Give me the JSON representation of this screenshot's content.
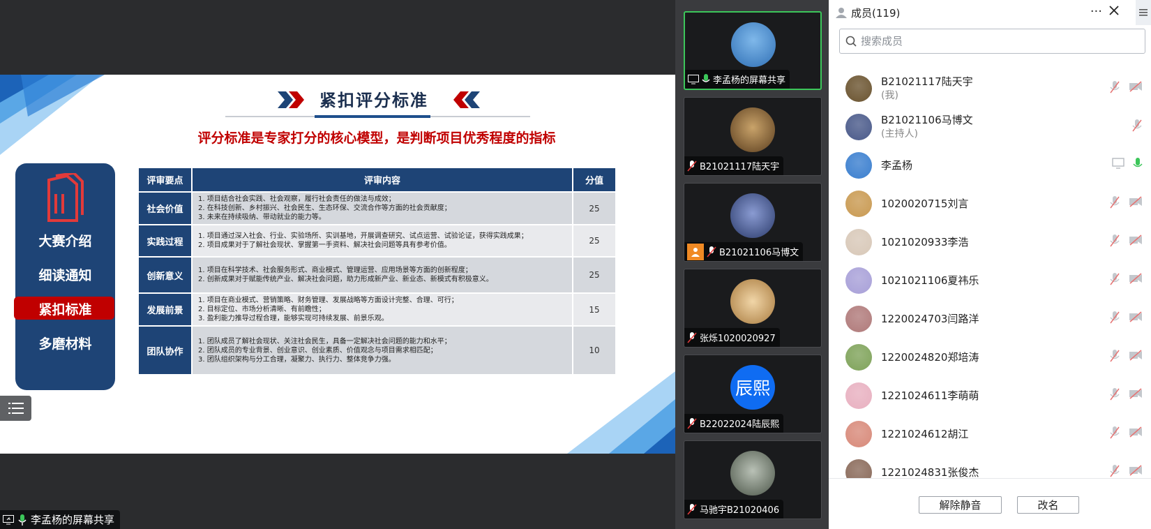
{
  "slide": {
    "title": "紧扣评分标准",
    "subtitle": "评分标准是专家打分的核心模型，是判断项目优秀程度的指标",
    "nav": [
      "大赛介绍",
      "细读通知",
      "紧扣标准",
      "多磨材料"
    ],
    "table": {
      "headers": [
        "评审要点",
        "评审内容",
        "分值"
      ],
      "rows": [
        {
          "aspect": "社会价值",
          "lines": [
            "1. 项目结合社会实践、社会观察，履行社会责任的做法与成效；",
            "2. 在科技创新、乡村振兴、社会民生、生态环保、交流合作等方面的社会贡献度；",
            "3. 未来在持续吸纳、带动就业的能力等。"
          ],
          "score": "25"
        },
        {
          "aspect": "实践过程",
          "lines": [
            "1. 项目通过深入社会、行业、实验场所、实训基地，开展调查研究、试点运营、试验论证，获得实践成果；",
            "2. 项目成果对于了解社会现状、掌握第一手资料、解决社会问题等具有参考价值。"
          ],
          "score": "25"
        },
        {
          "aspect": "创新意义",
          "lines": [
            "1. 项目在科学技术、社会服务形式、商业模式、管理运营、应用场景等方面的创新程度；",
            "2. 创新成果对于赋能传统产业、解决社会问题，助力形成新产业、新业态、新模式有积极意义。"
          ],
          "score": "25"
        },
        {
          "aspect": "发展前景",
          "lines": [
            "1. 项目在商业模式、营销策略、财务管理、发展战略等方面设计完整、合理、可行；",
            "2. 目标定位、市场分析清晰、有前瞻性；",
            "3. 盈利能力推导过程合理，能够实现可持续发展、前景乐观。"
          ],
          "score": "15"
        },
        {
          "aspect": "团队协作",
          "lines": [
            "1. 团队成员了解社会现状、关注社会民生，具备一定解决社会问题的能力和水平；",
            "2. 团队成员的专业背景、创业意识、创业素质、价值观念与项目需求相匹配；",
            "3. 团队组织架构与分工合理，凝聚力、执行力、整体竞争力强。"
          ],
          "score": "10"
        }
      ]
    }
  },
  "share_label": "李孟杨的屏幕共享",
  "video_tiles": [
    {
      "name": "李孟杨的屏幕共享",
      "active": true
    },
    {
      "name": "B21021117陆天宇",
      "active": false
    },
    {
      "name": "B21021106马博文",
      "active": false
    },
    {
      "name": "张烁1020020927",
      "active": false
    },
    {
      "name": "B22022024陆辰熙",
      "active": false,
      "avatar_text": "辰熙"
    },
    {
      "name": "马驰宇B21020406",
      "active": false
    }
  ],
  "panel": {
    "title": "成员(119)",
    "more": "···",
    "search_placeholder": "搜索成员",
    "members": [
      {
        "name": "B21021117陆天宇",
        "sub": "(我)"
      },
      {
        "name": "B21021106马博文",
        "sub": "(主持人)"
      },
      {
        "name": "李孟杨",
        "sub": ""
      },
      {
        "name": "1020020715刘言",
        "sub": ""
      },
      {
        "name": "1021020933李浩",
        "sub": ""
      },
      {
        "name": "1021021106夏祎乐",
        "sub": ""
      },
      {
        "name": "1220024703闫路洋",
        "sub": ""
      },
      {
        "name": "1220024820郑培涛",
        "sub": ""
      },
      {
        "name": "1221024611李萌萌",
        "sub": ""
      },
      {
        "name": "1221024612胡江",
        "sub": ""
      },
      {
        "name": "1221024831张俊杰",
        "sub": ""
      }
    ],
    "unmute_label": "解除静音",
    "rename_label": "改名"
  },
  "colors": {
    "slide_navy": "#1e4476",
    "slide_red": "#c00000",
    "active_green": "#3cc65a",
    "avatar_blue": "#0f6cf2"
  }
}
